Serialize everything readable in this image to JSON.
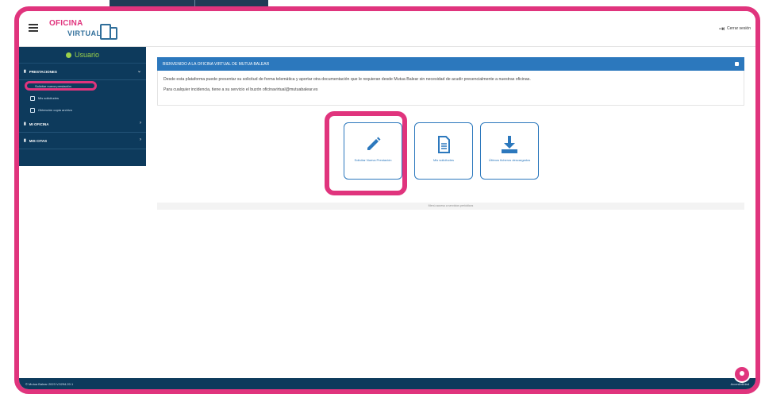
{
  "header": {
    "logo_line1": "OFICINA",
    "logo_line2": "VIRTUAL",
    "logout_label": "Cerrar sesión"
  },
  "sidebar": {
    "user_label": "Usuario",
    "sections": [
      {
        "label": "PRESTACIONES"
      },
      {
        "label": "MI OFICINA"
      },
      {
        "label": "MIS CITAS"
      }
    ],
    "sub_items": [
      {
        "label": "Solicitar nueva prestación"
      },
      {
        "label": "Mis solicitudes"
      },
      {
        "label": "Obtención copia archivo"
      }
    ]
  },
  "panel": {
    "title": "BIENVENIDO A LA OFICINA VIRTUAL DE MUTUA BALEAR",
    "paragraph1": "Desde esta plataforma puede presentar su solicitud de forma telemática y aportar otra documentación que le requieran desde Mutua Balear sin necesidad de acudir presencialmente a nuestras oficinas.",
    "paragraph2": "Para cualquier incidencia, tiene a su servicio el buzón oficinavirtual@mutuabalear.es"
  },
  "tiles": [
    {
      "label": "Solicitar Nueva Prestación",
      "icon": "pencil-icon"
    },
    {
      "label": "Mis solicitudes",
      "icon": "document-icon"
    },
    {
      "label": "Últimos ficheros descargados",
      "icon": "download-icon"
    }
  ],
  "status_text": "Menú acceso a servicios periódicos",
  "footer": {
    "left": "© Mutua Balear 2023 V.5294.20.1",
    "right": "Accesibilidad"
  },
  "colors": {
    "accent_pink": "#e0347d",
    "navy": "#0d3a5c",
    "blue": "#2c78bd",
    "green": "#9bd14a"
  }
}
